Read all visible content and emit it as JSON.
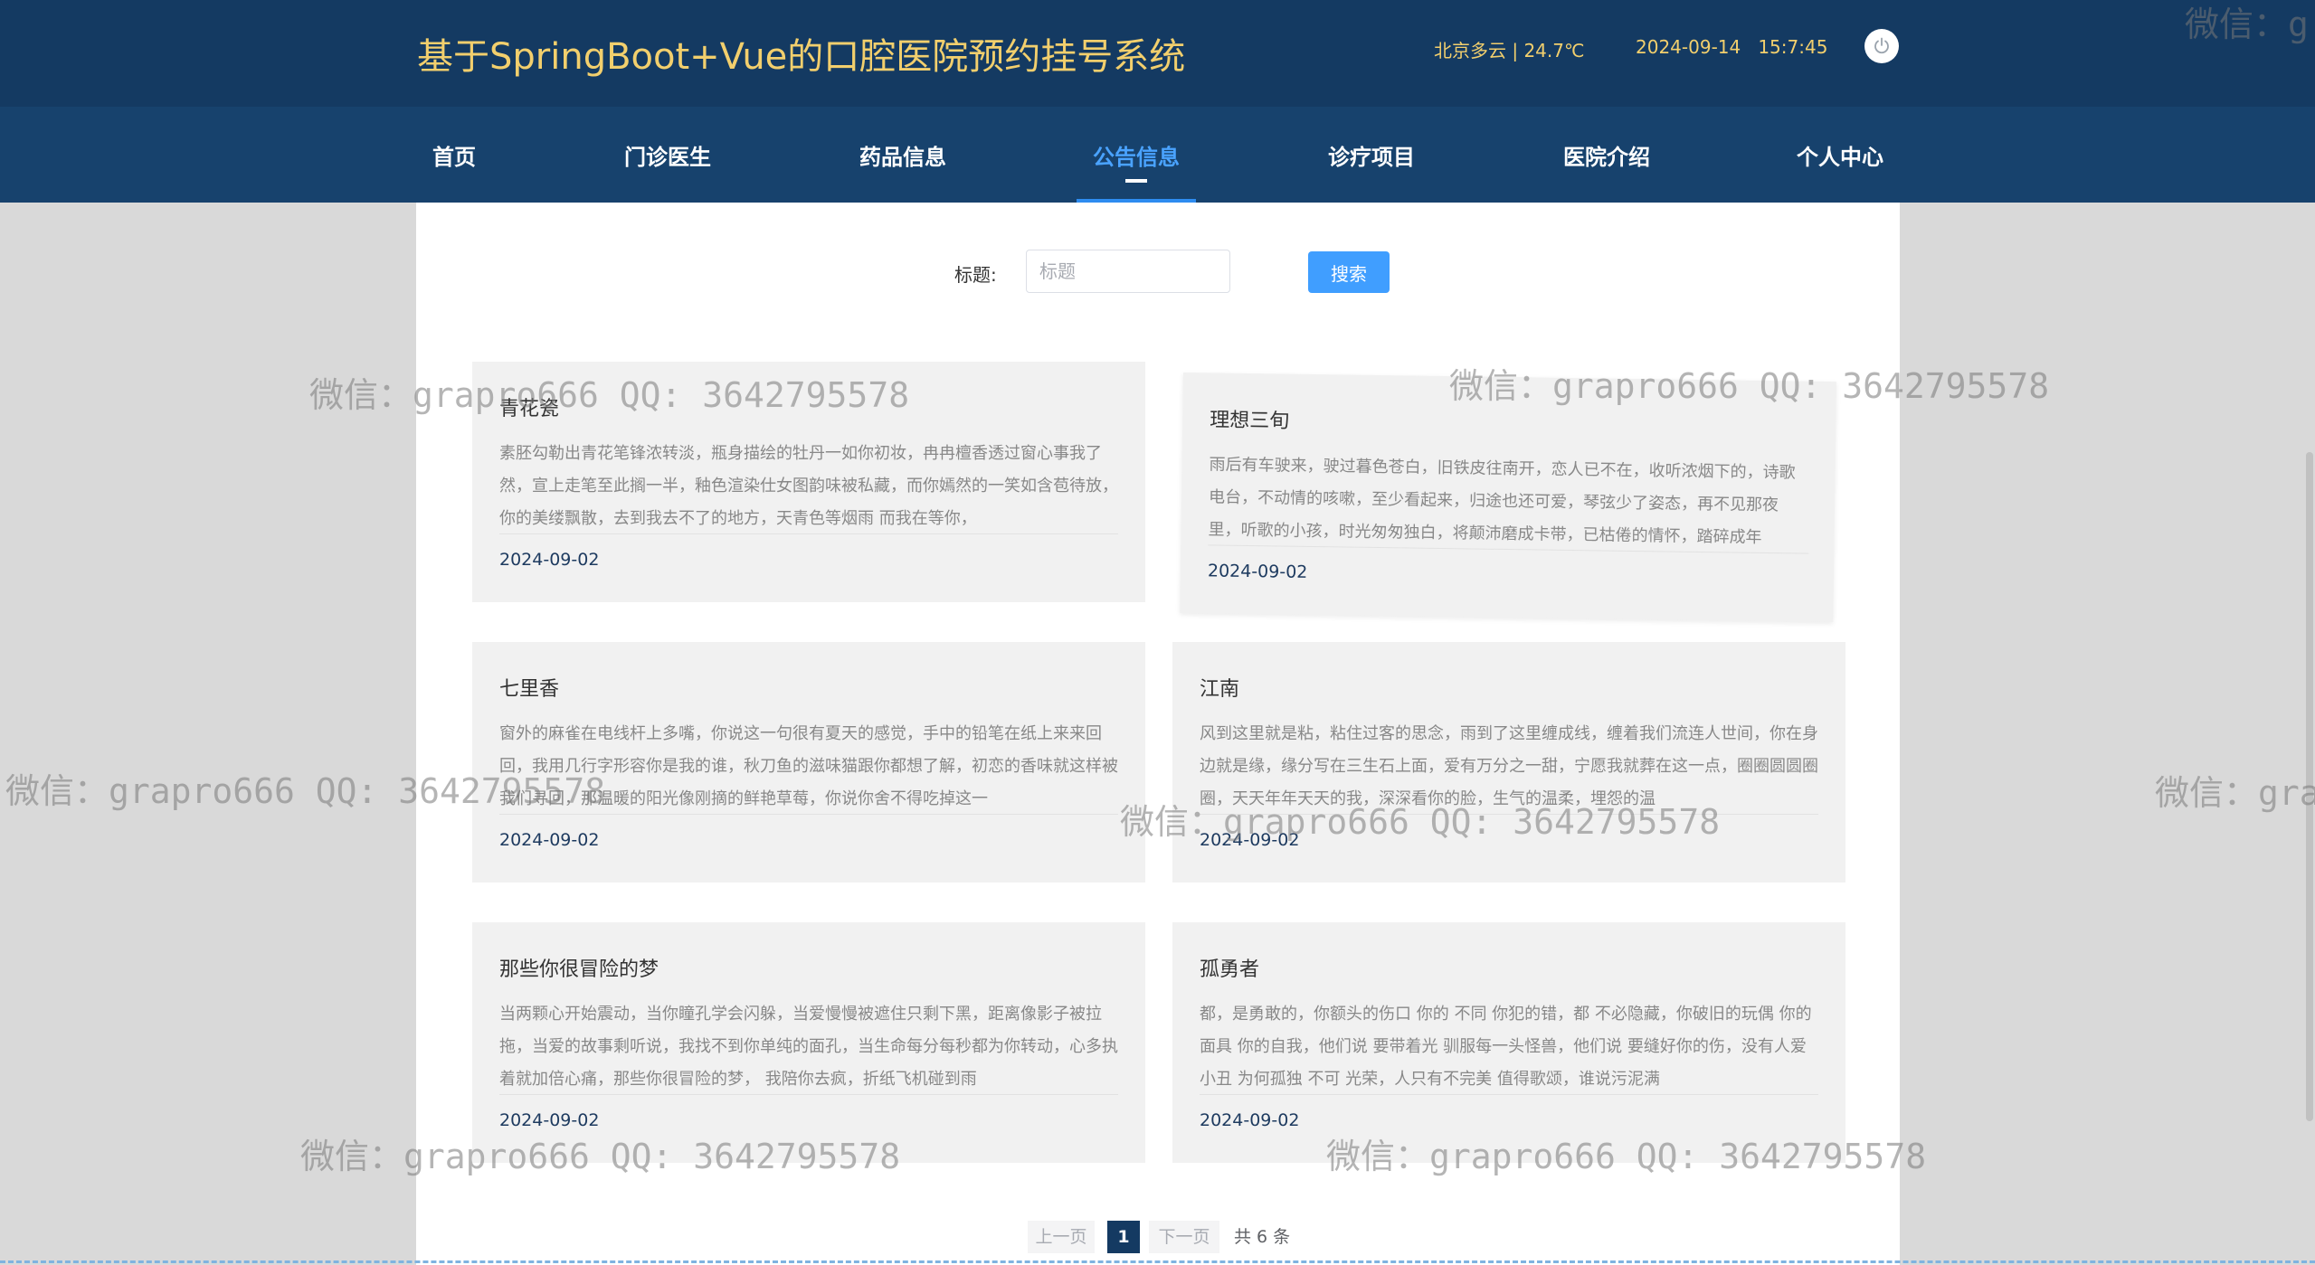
{
  "header": {
    "title": "基于SpringBoot+Vue的口腔医院预约挂号系统",
    "weather": "北京多云 | 24.7℃",
    "date": "2024-09-14",
    "time": "15:7:45"
  },
  "nav": {
    "items": [
      {
        "label": "首页"
      },
      {
        "label": "门诊医生"
      },
      {
        "label": "药品信息"
      },
      {
        "label": "公告信息"
      },
      {
        "label": "诊疗项目"
      },
      {
        "label": "医院介绍"
      },
      {
        "label": "个人中心"
      }
    ],
    "active": "公告信息"
  },
  "search": {
    "label": "标题:",
    "placeholder": "标题",
    "value": "",
    "button": "搜索"
  },
  "cards": [
    {
      "title": "青花瓷",
      "text": "素胚勾勒出青花笔锋浓转淡，瓶身描绘的牡丹一如你初妆，冉冉檀香透过窗心事我了然，宣上走笔至此搁一半，釉色渲染仕女图韵味被私藏，而你嫣然的一笑如含苞待放，你的美缕飘散，去到我去不了的地方，天青色等烟雨 而我在等你，",
      "date": "2024-09-02"
    },
    {
      "title": "理想三旬",
      "text": "雨后有车驶来，驶过暮色苍白，旧铁皮往南开，恋人已不在，收听浓烟下的，诗歌电台，不动情的咳嗽，至少看起来，归途也还可爱，琴弦少了姿态，再不见那夜里，听歌的小孩，时光匆匆独白，将颠沛磨成卡带，已枯倦的情怀，踏碎成年",
      "date": "2024-09-02"
    },
    {
      "title": "七里香",
      "text": "窗外的麻雀在电线杆上多嘴，你说这一句很有夏天的感觉，手中的铅笔在纸上来来回回，我用几行字形容你是我的谁，秋刀鱼的滋味猫跟你都想了解，初恋的香味就这样被我们寻回，那温暖的阳光像刚摘的鲜艳草莓，你说你舍不得吃掉这一",
      "date": "2024-09-02"
    },
    {
      "title": "江南",
      "text": "风到这里就是粘，粘住过客的思念，雨到了这里缠成线，缠着我们流连人世间，你在身边就是缘，缘分写在三生石上面，爱有万分之一甜，宁愿我就葬在这一点，圈圈圆圆圈圈，天天年年天天的我，深深看你的脸，生气的温柔，埋怨的温",
      "date": "2024-09-02"
    },
    {
      "title": "那些你很冒险的梦",
      "text": "当两颗心开始震动，当你瞳孔学会闪躲，当爱慢慢被遮住只剩下黑，距离像影子被拉拖，当爱的故事剩听说，我找不到你单纯的面孔，当生命每分每秒都为你转动，心多执着就加倍心痛，那些你很冒险的梦， 我陪你去疯，折纸飞机碰到雨",
      "date": "2024-09-02"
    },
    {
      "title": "孤勇者",
      "text": "都，是勇敢的，你额头的伤口 你的 不同 你犯的错，都 不必隐藏，你破旧的玩偶 你的 面具 你的自我，他们说 要带着光 驯服每一头怪兽，他们说 要缝好你的伤，没有人爱小丑 为何孤独 不可 光荣，人只有不完美 值得歌颂，谁说污泥满",
      "date": "2024-09-02"
    }
  ],
  "pagination": {
    "prev": "上一页",
    "current": "1",
    "next": "下一页",
    "total": "共 6 条"
  },
  "watermark": "微信：grapro666 QQ: 3642795578",
  "watermark_partial_a": "微信：g",
  "watermark_partial_b": "微信：gra",
  "colors": {
    "header_bg": "#143a62",
    "nav_bg": "#17426d",
    "title_color": "#f2cf6d",
    "nav_active": "#4aa3ff",
    "search_button": "#409eff",
    "card_bg": "#f1f1f1"
  },
  "icons": {
    "power": "power-icon"
  }
}
